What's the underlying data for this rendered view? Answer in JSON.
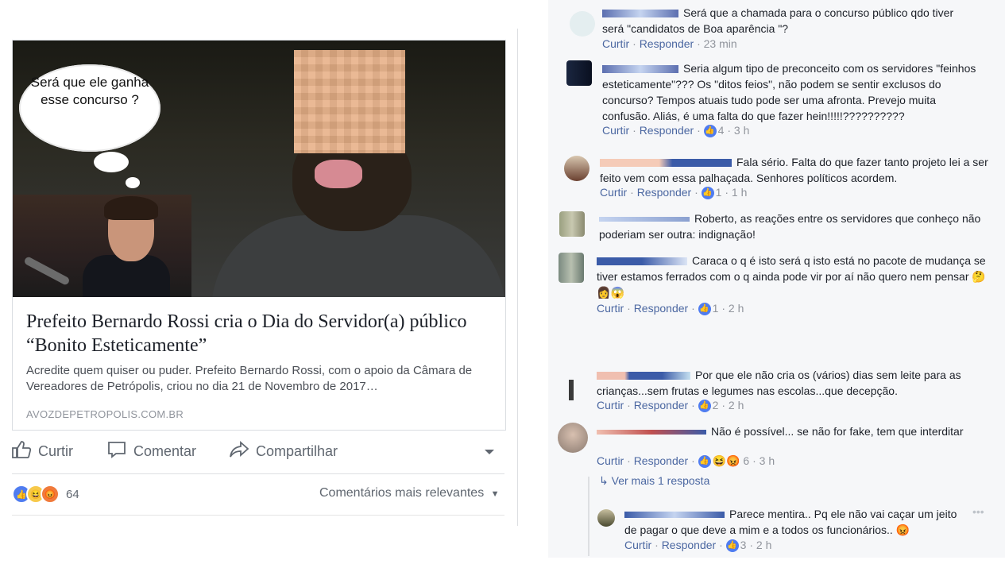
{
  "post": {
    "thought_bubble": "Será que ele ganha esse concurso ?",
    "card_title": "Prefeito Bernardo Rossi cria o Dia do Servidor(a) público “Bonito Esteticamente”",
    "card_description": "Acredite quem quiser ou puder. Prefeito Bernardo Rossi, com o apoio da Câmara de Vereadores de Petrópolis, criou no dia 21 de Novembro de 2017…",
    "card_domain": "AVOZDEPETROPOLIS.COM.BR",
    "actions": {
      "like": "Curtir",
      "comment": "Comentar",
      "share": "Compartilhar"
    },
    "reaction_count": "64",
    "sort_label": "Comentários mais relevantes"
  },
  "comments": [
    {
      "text": "Será que a chamada para o concurso público qdo tiver será \"candidatos de Boa aparência \"?",
      "like": "Curtir",
      "reply": "Responder",
      "likes": "",
      "time": "23 min"
    },
    {
      "text": "Seria algum tipo de preconceito com os servidores \"feinhos esteticamente\"??? Os \"ditos feios\", não podem se sentir exclusos do concurso? Tempos atuais tudo pode ser uma afronta. Prevejo muita confusão. Aliás, é uma falta do que fazer hein!!!!!??????????",
      "like": "Curtir",
      "reply": "Responder",
      "likes": "4",
      "time": "3 h"
    },
    {
      "text": "Fala sério. Falta do que fazer tanto projeto lei a ser feito vem com essa palhaçada. Senhores políticos acordem.",
      "like": "Curtir",
      "reply": "Responder",
      "likes": "1",
      "time": "1 h"
    },
    {
      "text": "Roberto, as reações entre os servidores que conheço não poderiam ser outra: indignação!",
      "like": "",
      "reply": "",
      "likes": "",
      "time": ""
    },
    {
      "text": "Caraca o q é isto será q isto está no pacote de mudança se tiver estamos ferrados com o q ainda pode vir por aí não quero nem pensar",
      "like": "Curtir",
      "reply": "Responder",
      "likes": "1",
      "time": "2 h"
    },
    {
      "text": "Por que ele não cria os (vários) dias sem leite para as crianças...sem frutas e legumes nas escolas...que decepção.",
      "like": "Curtir",
      "reply": "Responder",
      "likes": "2",
      "time": "2 h"
    },
    {
      "text": "Não é possível... se não for fake, tem que interditar",
      "like": "Curtir",
      "reply": "Responder",
      "likes": "6",
      "time": "3 h"
    },
    {
      "text": "Parece mentira.. Pq ele não vai caçar um jeito de pagar o que deve a mim e a todos os funcionários..",
      "like": "Curtir",
      "reply": "Responder",
      "likes": "3",
      "time": "2 h"
    }
  ],
  "more_replies": "Ver mais 1 resposta",
  "colors": {
    "link": "#4b67a1",
    "meta": "#90949c",
    "like_blue": "#4f7cf0",
    "panel_bg": "#f6f7f9"
  }
}
